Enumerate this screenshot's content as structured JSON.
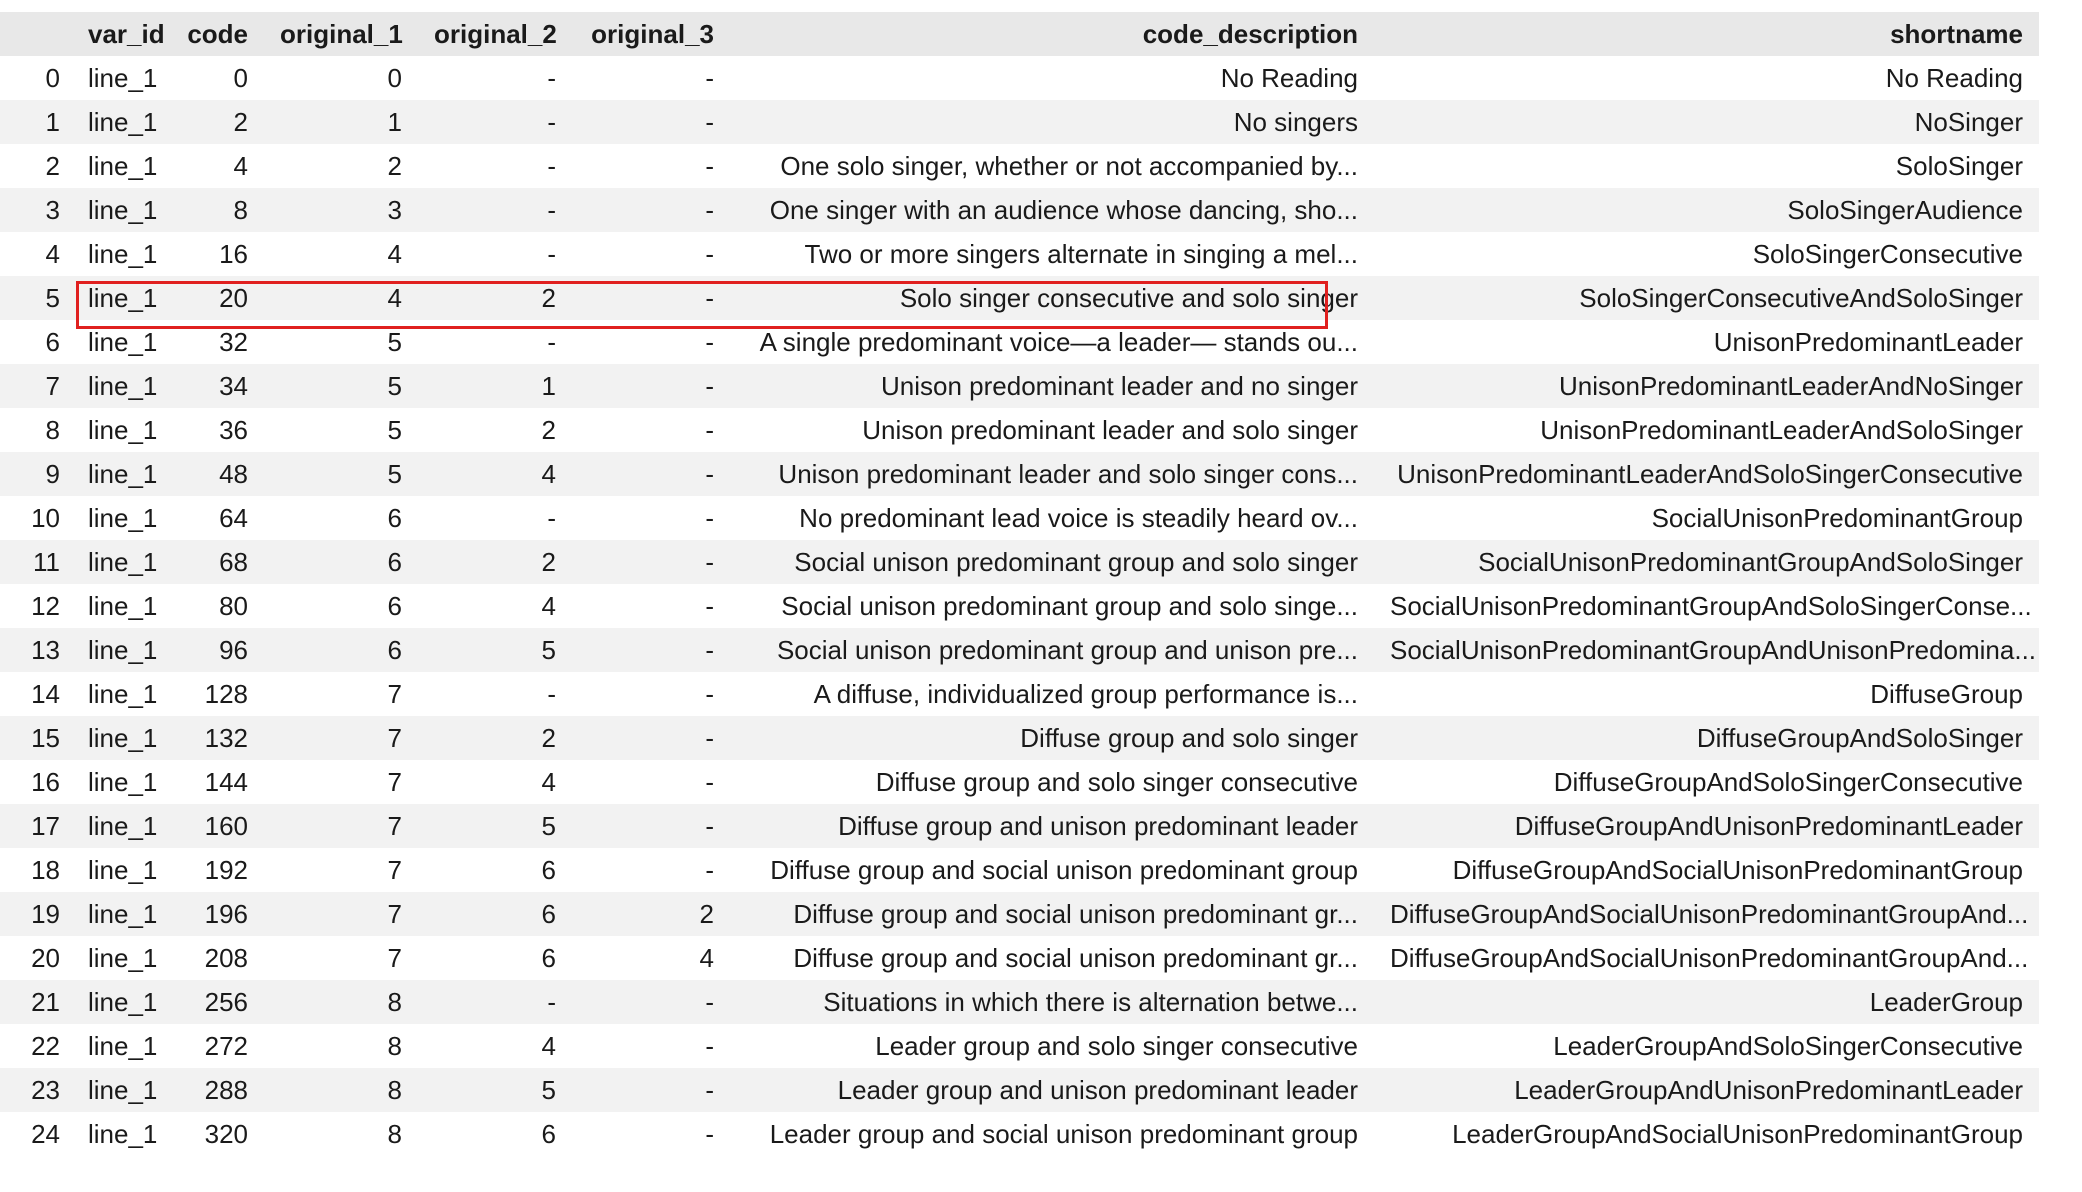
{
  "table": {
    "columns": [
      "",
      "var_id",
      "code",
      "original_1",
      "original_2",
      "original_3",
      "code_description",
      "shortname"
    ],
    "rows": [
      [
        "0",
        "line_1",
        "0",
        "0",
        "-",
        "-",
        "No Reading",
        "No Reading"
      ],
      [
        "1",
        "line_1",
        "2",
        "1",
        "-",
        "-",
        "No singers",
        "NoSinger"
      ],
      [
        "2",
        "line_1",
        "4",
        "2",
        "-",
        "-",
        "One solo singer, whether or not accompanied by...",
        "SoloSinger"
      ],
      [
        "3",
        "line_1",
        "8",
        "3",
        "-",
        "-",
        "One singer with an audience whose dancing, sho...",
        "SoloSingerAudience"
      ],
      [
        "4",
        "line_1",
        "16",
        "4",
        "-",
        "-",
        "Two or more singers alternate in singing a mel...",
        "SoloSingerConsecutive"
      ],
      [
        "5",
        "line_1",
        "20",
        "4",
        "2",
        "-",
        "Solo singer consecutive and solo singer",
        "SoloSingerConsecutiveAndSoloSinger"
      ],
      [
        "6",
        "line_1",
        "32",
        "5",
        "-",
        "-",
        "A single predominant voice—a leader— stands ou...",
        "UnisonPredominantLeader"
      ],
      [
        "7",
        "line_1",
        "34",
        "5",
        "1",
        "-",
        "Unison predominant leader and no singer",
        "UnisonPredominantLeaderAndNoSinger"
      ],
      [
        "8",
        "line_1",
        "36",
        "5",
        "2",
        "-",
        "Unison predominant leader and solo singer",
        "UnisonPredominantLeaderAndSoloSinger"
      ],
      [
        "9",
        "line_1",
        "48",
        "5",
        "4",
        "-",
        "Unison predominant leader and solo singer cons...",
        "UnisonPredominantLeaderAndSoloSingerConsecutive"
      ],
      [
        "10",
        "line_1",
        "64",
        "6",
        "-",
        "-",
        "No predominant lead voice is steadily heard ov...",
        "SocialUnisonPredominantGroup"
      ],
      [
        "11",
        "line_1",
        "68",
        "6",
        "2",
        "-",
        "Social unison predominant group and solo singer",
        "SocialUnisonPredominantGroupAndSoloSinger"
      ],
      [
        "12",
        "line_1",
        "80",
        "6",
        "4",
        "-",
        "Social unison predominant group and solo singe...",
        "SocialUnisonPredominantGroupAndSoloSingerConse..."
      ],
      [
        "13",
        "line_1",
        "96",
        "6",
        "5",
        "-",
        "Social unison predominant group and unison pre...",
        "SocialUnisonPredominantGroupAndUnisonPredomina..."
      ],
      [
        "14",
        "line_1",
        "128",
        "7",
        "-",
        "-",
        "A diffuse, individualized group performance is...",
        "DiffuseGroup"
      ],
      [
        "15",
        "line_1",
        "132",
        "7",
        "2",
        "-",
        "Diffuse group and solo singer",
        "DiffuseGroupAndSoloSinger"
      ],
      [
        "16",
        "line_1",
        "144",
        "7",
        "4",
        "-",
        "Diffuse group and solo singer consecutive",
        "DiffuseGroupAndSoloSingerConsecutive"
      ],
      [
        "17",
        "line_1",
        "160",
        "7",
        "5",
        "-",
        "Diffuse group and unison predominant leader",
        "DiffuseGroupAndUnisonPredominantLeader"
      ],
      [
        "18",
        "line_1",
        "192",
        "7",
        "6",
        "-",
        "Diffuse group and social unison predominant group",
        "DiffuseGroupAndSocialUnisonPredominantGroup"
      ],
      [
        "19",
        "line_1",
        "196",
        "7",
        "6",
        "2",
        "Diffuse group and social unison predominant gr...",
        "DiffuseGroupAndSocialUnisonPredominantGroupAnd..."
      ],
      [
        "20",
        "line_1",
        "208",
        "7",
        "6",
        "4",
        "Diffuse group and social unison predominant gr...",
        "DiffuseGroupAndSocialUnisonPredominantGroupAnd..."
      ],
      [
        "21",
        "line_1",
        "256",
        "8",
        "-",
        "-",
        "Situations in which there is alternation betwe...",
        "LeaderGroup"
      ],
      [
        "22",
        "line_1",
        "272",
        "8",
        "4",
        "-",
        "Leader group and solo singer consecutive",
        "LeaderGroupAndSoloSingerConsecutive"
      ],
      [
        "23",
        "line_1",
        "288",
        "8",
        "5",
        "-",
        "Leader group and unison predominant leader",
        "LeaderGroupAndUnisonPredominantLeader"
      ],
      [
        "24",
        "line_1",
        "320",
        "8",
        "6",
        "-",
        "Leader group and social unison predominant group",
        "LeaderGroupAndSocialUnisonPredominantGroup"
      ]
    ],
    "highlighted_row": 5,
    "highlight_color": "#e0201f"
  }
}
